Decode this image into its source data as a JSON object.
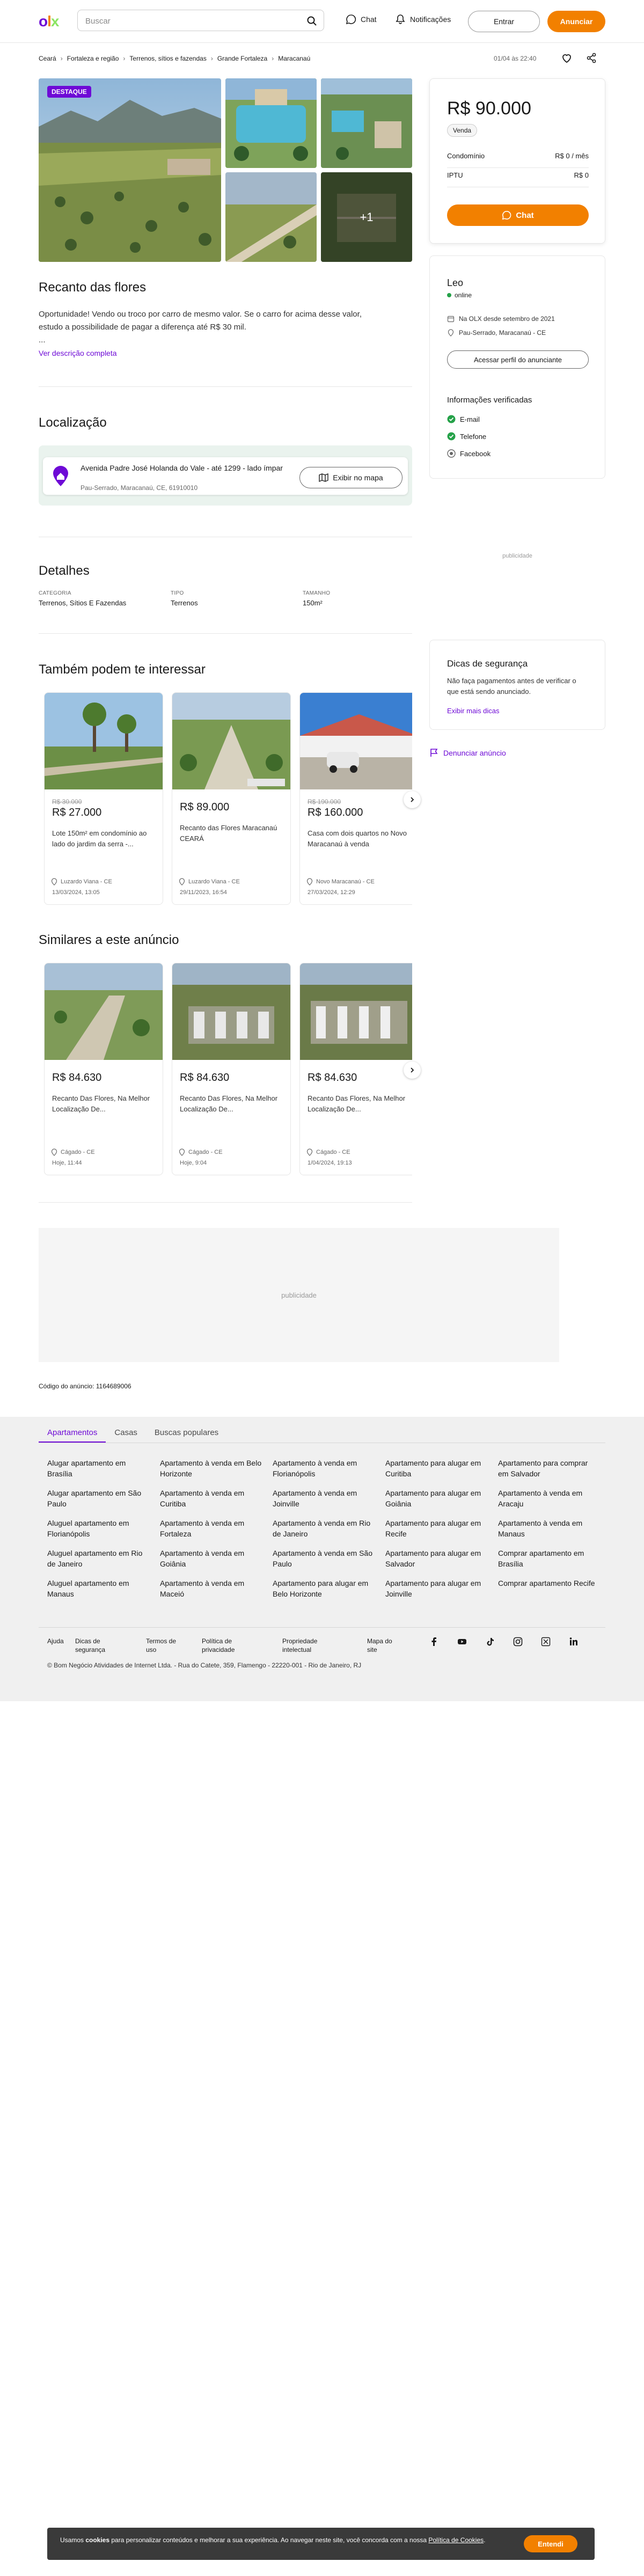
{
  "header": {
    "logo": [
      "o",
      "l",
      "x"
    ],
    "logo_colors": [
      "#6e0ad6",
      "#f28000",
      "#8ce563"
    ],
    "search_placeholder": "Buscar",
    "chat_label": "Chat",
    "notifications_label": "Notificações",
    "login_label": "Entrar",
    "post_label": "Anunciar"
  },
  "breadcrumb": [
    "Ceará",
    "Fortaleza e região",
    "Terrenos, sítios e fazendas",
    "Grande Fortaleza",
    "Maracanaú"
  ],
  "published": "01/04 às 22:40",
  "gallery": {
    "badge": "DESTAQUE",
    "more": "+1"
  },
  "listing": {
    "title": "Recanto das flores",
    "description_lines": [
      "Oportunidade! Vendo ou troco por carro de mesmo valor. Se o carro for acima desse valor,",
      "estudo a possibilidade de pagar a diferença até R$ 30 mil.",
      "..."
    ],
    "see_full": "Ver descrição completa"
  },
  "location": {
    "heading": "Localização",
    "street": "Avenida Padre José Holanda do Vale - até 1299 - lado ímpar",
    "area": "Pau-Serrado, Maracanaú, CE, 61910010",
    "map_button": "Exibir no mapa"
  },
  "details": {
    "heading": "Detalhes",
    "items": [
      {
        "label": "CATEGORIA",
        "value": "Terrenos, Sítios E Fazendas"
      },
      {
        "label": "TIPO",
        "value": "Terrenos"
      },
      {
        "label": "TAMANHO",
        "value": "150m²"
      }
    ]
  },
  "related": {
    "heading": "Também podem te interessar",
    "cards": [
      {
        "old": "R$ 30.000",
        "price": "R$ 27.000",
        "title": "Lote 150m² em condomínio ao lado do jardim da serra -...",
        "loc": "Luzardo Viana - CE",
        "date": "13/03/2024, 13:05"
      },
      {
        "old": "",
        "price": "R$ 89.000",
        "title": "Recanto das Flores Maracanaú CEARÁ",
        "loc": "Luzardo Viana - CE",
        "date": "29/11/2023, 16:54"
      },
      {
        "old": "R$ 190.000",
        "price": "R$ 160.000",
        "title": "Casa com dois quartos no Novo Maracanaú à venda",
        "loc": "Novo Maracanaú - CE",
        "date": "27/03/2024, 12:29"
      }
    ]
  },
  "similar": {
    "heading": "Similares a este anúncio",
    "cards": [
      {
        "price": "R$ 84.630",
        "title": "Recanto Das Flores, Na Melhor Localização De...",
        "loc": "Cágado - CE",
        "date": "Hoje, 11:44"
      },
      {
        "price": "R$ 84.630",
        "title": "Recanto Das Flores, Na Melhor Localização De...",
        "loc": "Cágado - CE",
        "date": "Hoje, 9:04"
      },
      {
        "price": "R$ 84.630",
        "title": "Recanto Das Flores, Na Melhor Localização De...",
        "loc": "Cágado - CE",
        "date": "1/04/2024, 19:13"
      }
    ]
  },
  "ad_label": "publicidade",
  "ad_code": "Código do anúncio: 1164689006",
  "price_box": {
    "price": "R$ 90.000",
    "type": "Venda",
    "condo_label": "Condomínio",
    "condo_value": "R$ 0 / mês",
    "iptu_label": "IPTU",
    "iptu_value": "R$ 0",
    "chat": "Chat"
  },
  "seller": {
    "name": "Leo",
    "status": "online",
    "since": "Na OLX desde setembro de 2021",
    "location": "Pau-Serrado, Maracanaú - CE",
    "profile_button": "Acessar perfil do anunciante",
    "verified_title": "Informações verificadas",
    "verified": [
      "E-mail",
      "Telefone",
      "Facebook"
    ]
  },
  "safety": {
    "title": "Dicas de segurança",
    "text": "Não faça pagamentos antes de verificar o que está sendo anunciado.",
    "link": "Exibir mais dicas"
  },
  "report": "Denunciar anúncio",
  "footer": {
    "tabs": [
      "Apartamentos",
      "Casas",
      "Buscas populares"
    ],
    "links": [
      [
        "Alugar apartamento em Brasília",
        "Alugar apartamento em São Paulo",
        "Aluguel apartamento em Florianópolis",
        "Aluguel apartamento em Rio de Janeiro",
        "Aluguel apartamento em Manaus"
      ],
      [
        "Apartamento à venda em Belo Horizonte",
        "Apartamento à venda em Curitiba",
        "Apartamento à venda em Fortaleza",
        "Apartamento à venda em Goiânia",
        "Apartamento à venda em Maceió"
      ],
      [
        "Apartamento à venda em Florianópolis",
        "Apartamento à venda em Joinville",
        "Apartamento à venda em Rio de Janeiro",
        "Apartamento à venda em São Paulo",
        "Apartamento para alugar em Belo Horizonte"
      ],
      [
        "Apartamento para alugar em Curitiba",
        "Apartamento para alugar em Goiânia",
        "Apartamento para alugar em Recife",
        "Apartamento para alugar em Salvador",
        "Apartamento para alugar em Joinville"
      ],
      [
        "Apartamento para comprar em Salvador",
        "Apartamento à venda em Aracaju",
        "Apartamento à venda em Manaus",
        "Comprar apartamento em Brasília",
        "Comprar apartamento Recife"
      ]
    ],
    "bottom_links": [
      "Ajuda",
      "Dicas de segurança",
      "Termos de uso",
      "Política de privacidade",
      "Propriedade intelectual",
      "Mapa do site"
    ],
    "copyright": "© Bom Negócio Atividades de Internet Ltda. - Rua do Catete, 359, Flamengo - 22220-001 - Rio de Janeiro, RJ"
  },
  "cookie": {
    "prefix": "Usamos ",
    "bold": "cookies",
    "middle": " para personalizar conteúdos e melhorar a sua experiência. Ao navegar neste site, você concorda com a nossa ",
    "link": "Política de Cookies",
    "suffix": ".",
    "button": "Entendi"
  }
}
